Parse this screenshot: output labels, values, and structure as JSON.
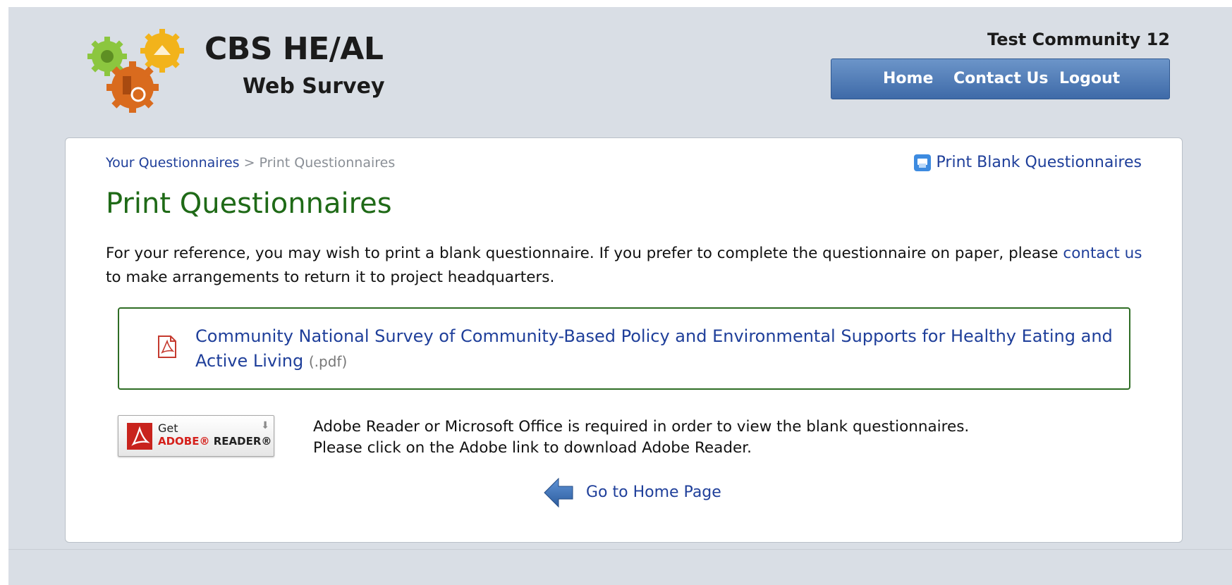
{
  "header": {
    "brand_title": "CBS HE/AL",
    "brand_subtitle": "Web Survey",
    "community": "Test Community 12",
    "nav": [
      {
        "label": "Home"
      },
      {
        "label": "Contact Us"
      },
      {
        "label": "Logout"
      }
    ]
  },
  "breadcrumb": {
    "parent": "Your Questionnaires",
    "separator": ">",
    "current": "Print Questionnaires"
  },
  "actions": {
    "print_blank": "Print Blank Questionnaires"
  },
  "main": {
    "title": "Print Questionnaires",
    "intro_before": "For your reference, you may wish to print a blank questionnaire. If you prefer to complete the questionnaire on paper, please ",
    "intro_link": "contact us",
    "intro_after": " to make arrangements to return it to project headquarters.",
    "document": {
      "title": "Community National Survey of Community-Based Policy and Environmental Supports for Healthy Eating and Active Living",
      "ext": "(.pdf)"
    },
    "adobe": {
      "get": "Get",
      "brand": "ADOBE®",
      "product": "READER®"
    },
    "requirement_line1": "Adobe Reader or Microsoft Office is required in order to view the blank questionnaires.",
    "requirement_line2": "Please click on the Adobe link to download Adobe Reader.",
    "home_link": "Go to Home Page"
  },
  "colors": {
    "nav_bar": "#4f7db8",
    "title_green": "#1f6a17",
    "link_blue": "#1f3f9a",
    "page_bg": "#d9dee5"
  },
  "icons": [
    "gears-logo-icon",
    "printer-icon",
    "pdf-file-icon",
    "adobe-reader-icon",
    "download-arrow-icon",
    "back-arrow-icon"
  ]
}
